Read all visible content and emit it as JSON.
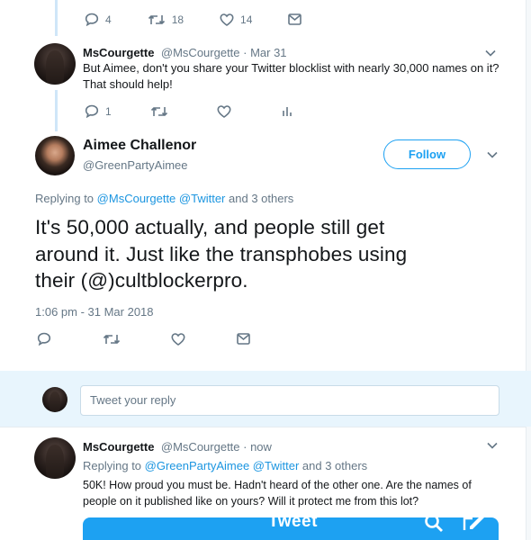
{
  "top_actions": {
    "reply_count": "4",
    "retweet_count": "18",
    "like_count": "14"
  },
  "reply1": {
    "name": "MsCourgette",
    "handle_date": "@MsCourgette · Mar 31",
    "text_line1": "But Aimee, don't you share your Twitter blocklist with nearly 30,000 names on it?",
    "text_line2": "That should help!",
    "reply_count": "1"
  },
  "main_tweet": {
    "name": "Aimee Challenor",
    "handle": "@GreenPartyAimee",
    "follow_label": "Follow",
    "replying_prefix": "Replying to",
    "replying_handles": "@MsCourgette @Twitter",
    "replying_suffix": "and 3 others",
    "text_line1": "It's 50,000 actually, and people still get",
    "text_line2": "around it. Just like the transphobes using",
    "text_line3": "their (@)cultblockerpro.",
    "timestamp": "1:06 pm - 31 Mar 2018"
  },
  "compose": {
    "placeholder": "Tweet your reply"
  },
  "reply2": {
    "name": "MsCourgette",
    "handle_date": "@MsCourgette · now",
    "replying_prefix": "Replying to",
    "replying_handles": "@GreenPartyAimee @Twitter",
    "replying_suffix": "and 3 others",
    "text_line1": "50K! How proud you must be. Hadn't heard of the other one. Are the names of",
    "text_line2": "people on it published like on yours? Will it protect me from this lot?",
    "image_caption": "Tweet"
  },
  "colors": {
    "accent": "#1da1f2",
    "link": "#1b95e0",
    "muted": "#657786",
    "thread": "#cfe6f8",
    "reply_bg": "#e8f5fd"
  },
  "icons": [
    "reply-icon",
    "retweet-icon",
    "like-icon",
    "message-icon",
    "analytics-icon",
    "chevron-down-icon",
    "search-icon",
    "compose-icon"
  ]
}
